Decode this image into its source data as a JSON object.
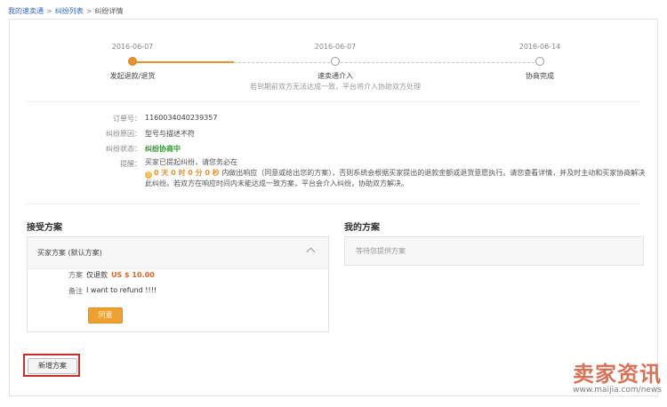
{
  "breadcrumb": {
    "home": "我的速卖通",
    "list": "纠纷列表",
    "current": "纠纷详情",
    "sep": ">"
  },
  "progress": {
    "steps": [
      {
        "date": "2016-06-07",
        "label": "发起退款/退货",
        "state": "active"
      },
      {
        "date": "2016-06-07",
        "label": "速卖通介入",
        "sub": "若到期前双方无法达成一致，平台将介入协助双方处理",
        "state": "pending"
      },
      {
        "date": "2016-06-14",
        "label": "协商完成",
        "state": "pending"
      }
    ],
    "accent_color": "#e8912c"
  },
  "info": {
    "order_label": "订单号：",
    "order_value": "1160034040239357",
    "reason_label": "纠纷原因：",
    "reason_value": "型号与描述不符",
    "status_label": "纠纷状态：",
    "status_value": "纠纷协商中",
    "tip_label": "提醒：",
    "tip_line1": "买家已提起纠纷，请您务必在",
    "tip_countdown": "0 天 0 时 0 分 0 秒",
    "tip_rest": "内做出响应（同意或给出您的方案），否则系统会根据买家提出的退款金额或退货意愿执行。请您查看详情，并及时主动和买家协商解决此纠纷。若双方在响应时间内未能达成一致方案，平台会介入纠纷，协助双方解决。"
  },
  "accept": {
    "title": "接受方案",
    "plan_head": "买家方案 (默认方案)",
    "plan_label": "方案",
    "plan_text": "仅退款",
    "plan_price": "US $ 10.00",
    "remark_label": "备注",
    "remark_text": "I want to refund !!!!",
    "agree_button": "同意"
  },
  "mine": {
    "title": "我的方案",
    "placeholder": "等待您提供方案"
  },
  "add_button": "新增方案",
  "watermark": {
    "text": "卖家资讯",
    "url": "www.maijia.com/news"
  }
}
